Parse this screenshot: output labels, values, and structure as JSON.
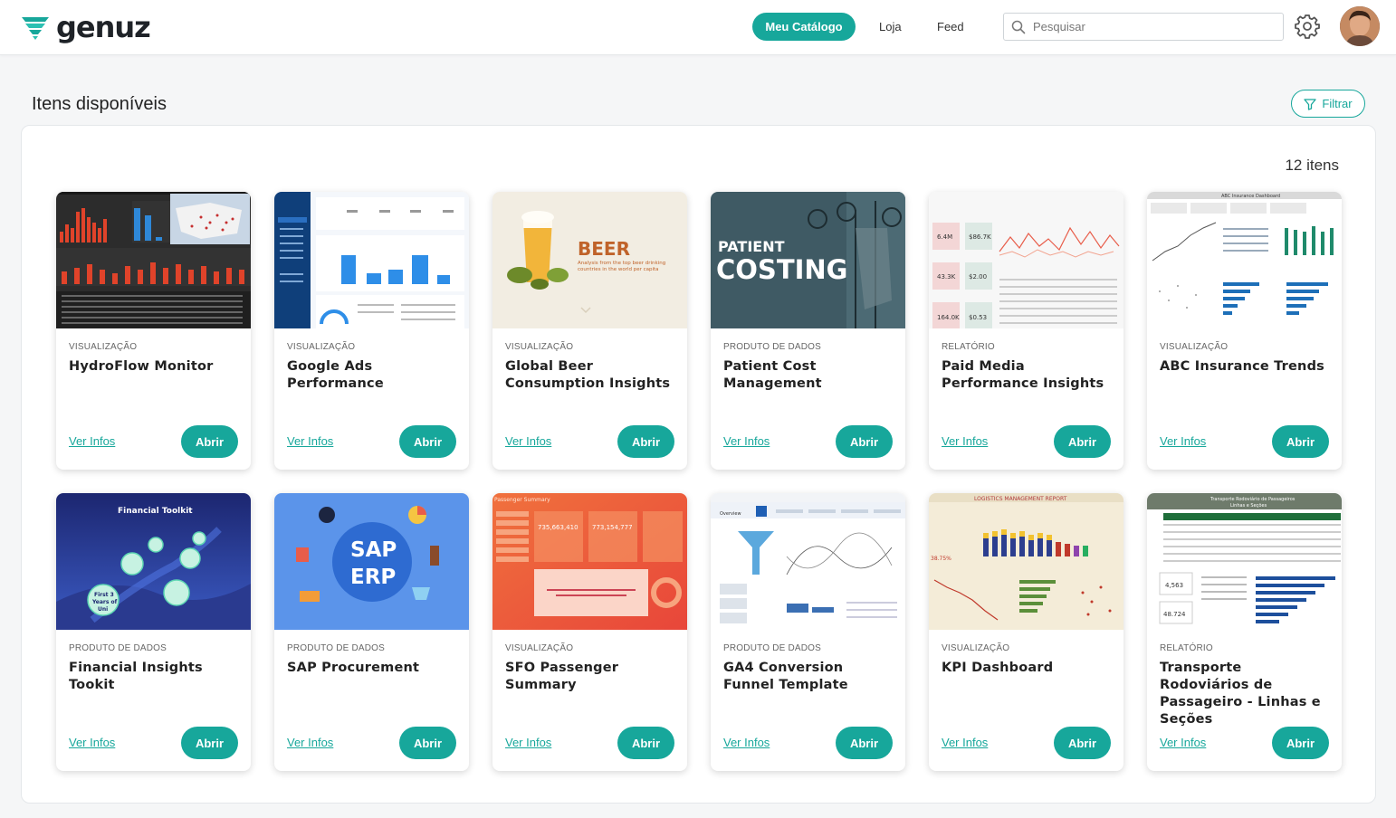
{
  "header": {
    "logo_text": "genuz",
    "nav": {
      "active": "Meu Catálogo",
      "store": "Loja",
      "feed": "Feed"
    },
    "search_placeholder": "Pesquisar"
  },
  "page": {
    "title": "Itens disponíveis",
    "filter_label": "Filtrar",
    "count": "12 itens"
  },
  "cards": [
    {
      "category": "VISUALIZAÇÃO",
      "title": "HydroFlow Monitor",
      "info": "Ver Infos",
      "open": "Abrir"
    },
    {
      "category": "VISUALIZAÇÃO",
      "title": "Google Ads Performance",
      "info": "Ver Infos",
      "open": "Abrir"
    },
    {
      "category": "VISUALIZAÇÃO",
      "title": "Global Beer Consumption Insights",
      "info": "Ver Infos",
      "open": "Abrir",
      "thumb_text": "BEER",
      "thumb_sub": "Analysis from the top beer drinking countries in the world per capita"
    },
    {
      "category": "PRODUTO DE DADOS",
      "title": "Patient Cost Management",
      "info": "Ver Infos",
      "open": "Abrir",
      "thumb_line1": "PATIENT",
      "thumb_line2": "COSTING"
    },
    {
      "category": "RELATÓRIO",
      "title": "Paid Media Performance Insights",
      "info": "Ver Infos",
      "open": "Abrir",
      "thumb_kpis": [
        "6.4M",
        "$86.7K",
        "43.3K",
        "$2.00",
        "164.0K",
        "$0.53"
      ]
    },
    {
      "category": "VISUALIZAÇÃO",
      "title": "ABC Insurance Trends",
      "info": "Ver Infos",
      "open": "Abrir",
      "thumb_text": "ABC Insurance Dashboard"
    },
    {
      "category": "PRODUTO DE DADOS",
      "title": "Financial Insights Tookit",
      "info": "Ver Infos",
      "open": "Abrir",
      "thumb_text": "Financial Toolkit",
      "thumb_bubble": "First 3 Years of Uni"
    },
    {
      "category": "PRODUTO DE DADOS",
      "title": "SAP Procurement",
      "info": "Ver Infos",
      "open": "Abrir",
      "thumb_line1": "SAP",
      "thumb_line2": "ERP"
    },
    {
      "category": "VISUALIZAÇÃO",
      "title": "SFO Passenger Summary",
      "info": "Ver Infos",
      "open": "Abrir",
      "thumb_text": "Passenger Summary",
      "thumb_kpis": [
        "735,663,410",
        "773,154,777"
      ]
    },
    {
      "category": "PRODUTO DE DADOS",
      "title": "GA4 Conversion Funnel Template",
      "info": "Ver Infos",
      "open": "Abrir",
      "thumb_text": "Overview"
    },
    {
      "category": "VISUALIZAÇÃO",
      "title": "KPI Dashboard",
      "info": "Ver Infos",
      "open": "Abrir",
      "thumb_text": "LOGISTICS MANAGEMENT REPORT",
      "thumb_kpi": "38.75%"
    },
    {
      "category": "RELATÓRIO",
      "title": "Transporte Rodoviários de Passageiro - Linhas e Seções",
      "info": "Ver Infos",
      "open": "Abrir",
      "thumb_text": "Transporte Rodoviário de Passageiros",
      "thumb_sub": "Linhas e Seções",
      "thumb_kpis": [
        "4,563",
        "48.724"
      ]
    }
  ],
  "colors": {
    "accent": "#17a79b",
    "text": "#222222",
    "background": "#f5f6f7"
  }
}
